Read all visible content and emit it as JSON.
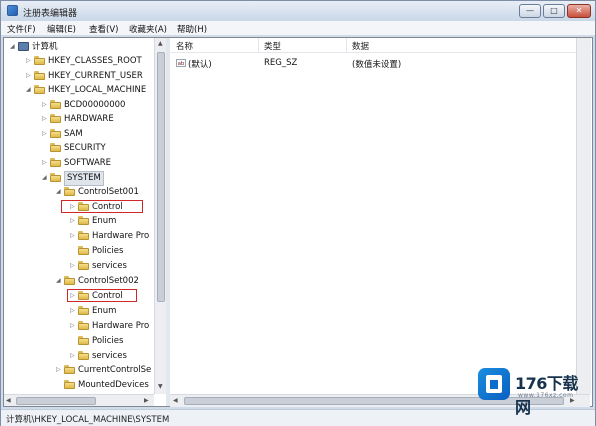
{
  "window": {
    "title": "注册表编辑器",
    "buttons": {
      "minimize": "—",
      "maximize": "□",
      "close": "✕"
    }
  },
  "menu": [
    "文件(F)",
    "编辑(E)",
    "查看(V)",
    "收藏夹(A)",
    "帮助(H)"
  ],
  "tree": [
    {
      "label": "计算机",
      "icon": "computer-icon",
      "toggle": "◢"
    },
    {
      "label": "HKEY_CLASSES_ROOT",
      "icon": "folder-icon",
      "toggle": "▷"
    },
    {
      "label": "HKEY_CURRENT_USER",
      "icon": "folder-icon",
      "toggle": "▷"
    },
    {
      "label": "HKEY_LOCAL_MACHINE",
      "icon": "folder-icon",
      "toggle": "◢"
    },
    {
      "label": "BCD00000000",
      "icon": "folder-icon",
      "toggle": "▷"
    },
    {
      "label": "HARDWARE",
      "icon": "folder-icon",
      "toggle": "▷"
    },
    {
      "label": "SAM",
      "icon": "folder-icon",
      "toggle": "▷"
    },
    {
      "label": "SECURITY",
      "icon": "folder-icon",
      "toggle": ""
    },
    {
      "label": "SOFTWARE",
      "icon": "folder-icon",
      "toggle": "▷"
    },
    {
      "label": "SYSTEM",
      "icon": "folder-icon",
      "toggle": "◢",
      "selected": true
    },
    {
      "label": "ControlSet001",
      "icon": "folder-icon",
      "toggle": "◢"
    },
    {
      "label": "Control",
      "icon": "folder-icon",
      "toggle": "▷",
      "highlighted": true
    },
    {
      "label": "Enum",
      "icon": "folder-icon",
      "toggle": "▷"
    },
    {
      "label": "Hardware Pro",
      "icon": "folder-icon",
      "toggle": "▷"
    },
    {
      "label": "Policies",
      "icon": "folder-icon",
      "toggle": ""
    },
    {
      "label": "services",
      "icon": "folder-icon",
      "toggle": "▷"
    },
    {
      "label": "ControlSet002",
      "icon": "folder-icon",
      "toggle": "◢"
    },
    {
      "label": "Control",
      "icon": "folder-icon",
      "toggle": "▷",
      "highlighted": true
    },
    {
      "label": "Enum",
      "icon": "folder-icon",
      "toggle": "▷"
    },
    {
      "label": "Hardware Pro",
      "icon": "folder-icon",
      "toggle": "▷"
    },
    {
      "label": "Policies",
      "icon": "folder-icon",
      "toggle": ""
    },
    {
      "label": "services",
      "icon": "folder-icon",
      "toggle": "▷"
    },
    {
      "label": "CurrentControlSe",
      "icon": "folder-icon",
      "toggle": "▷"
    },
    {
      "label": "MountedDevices",
      "icon": "folder-icon",
      "toggle": ""
    }
  ],
  "list": {
    "columns": [
      "名称",
      "类型",
      "数据"
    ],
    "rows": [
      {
        "icon": "string-value-icon",
        "icon_text": "ab",
        "name": "(默认)",
        "type": "REG_SZ",
        "data": "(数值未设置)"
      }
    ]
  },
  "status": {
    "path": "计算机\\HKEY_LOCAL_MACHINE\\SYSTEM"
  },
  "watermark": {
    "brand": "176下载网",
    "url": "www.176xz.com"
  },
  "colors": {
    "highlight_border": "#d02828",
    "title_gradient_top": "#e8eef6",
    "folder": "#f0cf6c"
  }
}
